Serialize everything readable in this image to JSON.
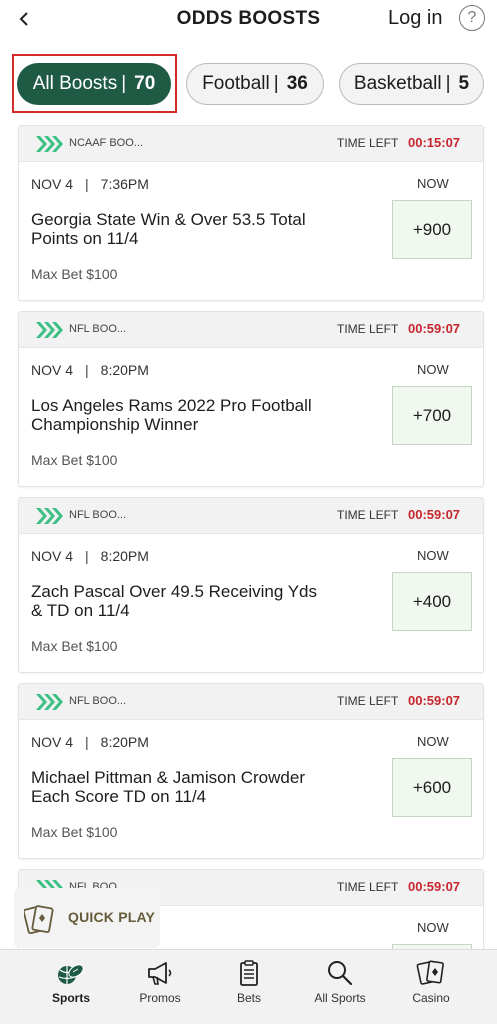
{
  "header": {
    "title": "ODDS BOOSTS",
    "login_label": "Log in",
    "help_glyph": "?"
  },
  "pills": [
    {
      "label": "All Boosts",
      "count": "70",
      "active": true
    },
    {
      "label": "Football",
      "count": "36",
      "active": false
    },
    {
      "label": "Basketball",
      "count": "5",
      "active": false
    }
  ],
  "boosts": [
    {
      "league": "NCAAF BOO...",
      "time_left_label": "TIME LEFT",
      "timer": "00:15:07",
      "date": "NOV 4",
      "time": "7:36PM",
      "now_label": "NOW",
      "description": "Georgia State Win & Over 53.5 Total Points on 11/4",
      "max_bet": "Max Bet $100",
      "odds": "+900"
    },
    {
      "league": "NFL BOO...",
      "time_left_label": "TIME LEFT",
      "timer": "00:59:07",
      "date": "NOV 4",
      "time": "8:20PM",
      "now_label": "NOW",
      "description": "Los Angeles Rams 2022 Pro Football Championship Winner",
      "max_bet": "Max Bet $100",
      "odds": "+700"
    },
    {
      "league": "NFL BOO...",
      "time_left_label": "TIME LEFT",
      "timer": "00:59:07",
      "date": "NOV 4",
      "time": "8:20PM",
      "now_label": "NOW",
      "description": "Zach Pascal Over 49.5 Receiving Yds & TD on 11/4",
      "max_bet": "Max Bet $100",
      "odds": "+400"
    },
    {
      "league": "NFL BOO...",
      "time_left_label": "TIME LEFT",
      "timer": "00:59:07",
      "date": "NOV 4",
      "time": "8:20PM",
      "now_label": "NOW",
      "description": "Michael Pittman & Jamison Crowder Each Score TD on 11/4",
      "max_bet": "Max Bet $100",
      "odds": "+600"
    },
    {
      "league": "NFL BOO",
      "time_left_label": "TIME LEFT",
      "timer": "00:59:07",
      "date": "",
      "time": "",
      "now_label": "NOW",
      "description": "",
      "max_bet": "",
      "odds": ""
    }
  ],
  "quick_play": {
    "label": "QUICK PLAY",
    "icon": "cards-icon"
  },
  "nav": [
    {
      "label": "Sports",
      "icon": "football-basketball-icon",
      "active": true
    },
    {
      "label": "Promos",
      "icon": "megaphone-icon",
      "active": false
    },
    {
      "label": "Bets",
      "icon": "bet-slip-icon",
      "active": false
    },
    {
      "label": "All Sports",
      "icon": "search-icon",
      "active": false
    },
    {
      "label": "Casino",
      "icon": "cards-icon",
      "active": false
    }
  ],
  "colors": {
    "brand_green": "#1f5a45",
    "accent_green": "#3dbf86",
    "timer_red": "#c8262e",
    "highlight_red": "#d42a2a"
  }
}
